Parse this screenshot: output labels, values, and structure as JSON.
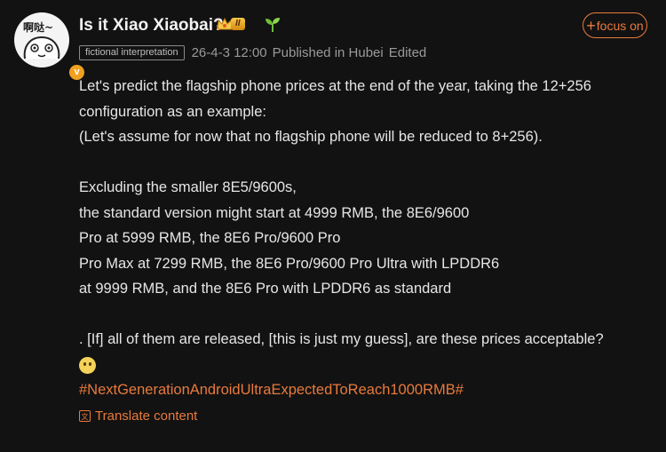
{
  "post": {
    "avatar_text": "啊哒~",
    "verified_badge": "v",
    "username": "Is it Xiao Xiaobai?",
    "level_badge": "II",
    "follow_label": "focus on",
    "follow_icon": "+",
    "tag": "fictional interpretation",
    "timestamp": "26-4-3 12:00",
    "location": "Published in Hubei",
    "edited": "Edited",
    "lines": [
      "Let's predict the flagship phone prices at the end of the year, taking the 12+256",
      "configuration as an example:",
      "(Let's assume for now that no flagship phone will be reduced to 8+256).",
      "",
      "Excluding the smaller 8E5/9600s,",
      "the standard version might start at 4999 RMB, the 8E6/9600",
      "Pro at 5999 RMB, the 8E6 Pro/9600 Pro",
      "Pro Max at 7299 RMB, the 8E6 Pro/9600 Pro Ultra with LPDDR6",
      "at 9999 RMB, and the 8E6 Pro with LPDDR6 as standard",
      "",
      ". [If] all of them are released, [this is just my guess], are these prices acceptable?"
    ],
    "hashtag": "#NextGenerationAndroidUltraExpectedToReach1000RMB#",
    "translate_label": "Translate content",
    "accent_color": "#e87a3c"
  }
}
